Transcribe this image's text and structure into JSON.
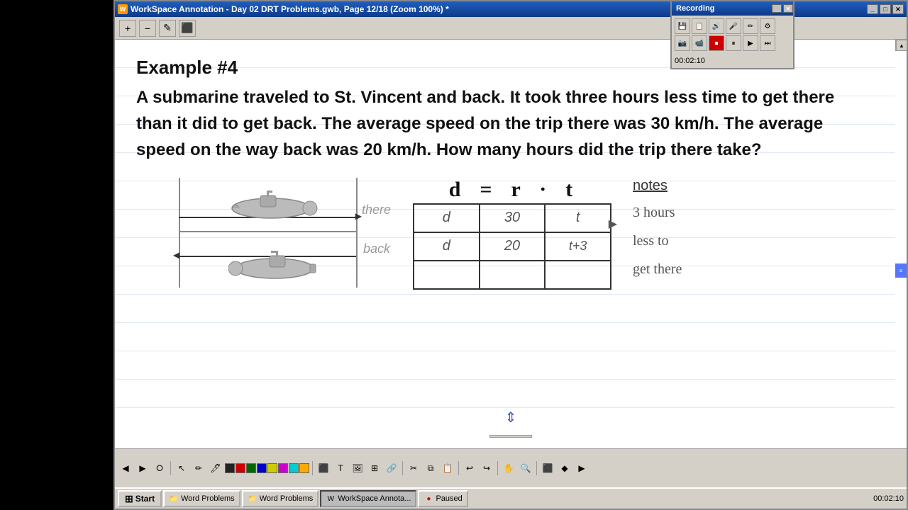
{
  "window": {
    "title": "WorkSpace Annotation - Day 02 DRT Problems.gwb, Page 12/18 (Zoom 100%) *",
    "icon": "W"
  },
  "toolbar": {
    "buttons": [
      "+",
      "−",
      "✎",
      "⬛"
    ]
  },
  "content": {
    "example_label": "Example #4",
    "problem_text": "A submarine traveled to St. Vincent and back. It took three hours less time to get there than it did to get back.  The average speed on the trip there was 30 km/h.  The average speed on the way back was 20 km/h.  How many hours did the trip there take?",
    "drt_header": "d  =  r  ·  t",
    "table": {
      "rows": [
        {
          "label": "there",
          "d": "d",
          "r": "30",
          "t": "t"
        },
        {
          "label": "back",
          "d": "d",
          "r": "20",
          "t": "t+3"
        },
        {
          "label": "",
          "d": "",
          "r": "",
          "t": ""
        }
      ]
    },
    "notes": {
      "title": "notes",
      "lines": [
        "3 hours",
        "less to",
        "get there"
      ]
    },
    "arrows": {
      "right_label": "there",
      "left_label": "back"
    }
  },
  "recording": {
    "title": "Recording",
    "time": "00:02:10"
  },
  "taskbar": {
    "start_label": "Start",
    "items": [
      {
        "label": "Word Problems",
        "icon": "📁"
      },
      {
        "label": "Word Problems",
        "icon": "📁"
      },
      {
        "label": "WorkSpace Annota...",
        "icon": "W"
      },
      {
        "label": "Paused",
        "icon": "🔴"
      }
    ],
    "time": "00:02:10"
  },
  "colors": {
    "accent": "#1e5fbd",
    "background": "#fff",
    "toolbar_bg": "#d4d0c8",
    "text_primary": "#111",
    "text_secondary": "#555"
  }
}
